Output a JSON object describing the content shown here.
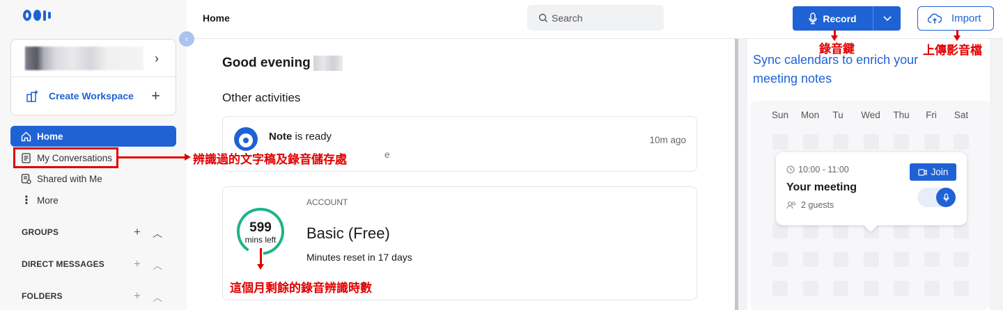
{
  "sidebar": {
    "create_workspace": "Create Workspace",
    "nav": [
      {
        "label": "Home",
        "icon": "home-icon"
      },
      {
        "label": "My Conversations",
        "icon": "conversations-icon"
      },
      {
        "label": "Shared with Me",
        "icon": "shared-icon"
      },
      {
        "label": "More",
        "icon": "more-vertical-icon"
      }
    ],
    "sections": [
      {
        "label": "GROUPS"
      },
      {
        "label": "DIRECT MESSAGES"
      },
      {
        "label": "FOLDERS"
      }
    ]
  },
  "header": {
    "title": "Home",
    "search_placeholder": "Search",
    "record_label": "Record",
    "import_label": "Import"
  },
  "main": {
    "greeting": "Good evening",
    "other_activities": "Other activities",
    "activity": {
      "bold": "Note",
      "rest": " is ready",
      "subtext": "e",
      "time": "10m ago"
    },
    "account": {
      "section_label": "ACCOUNT",
      "minutes": "599",
      "minutes_caption": "mins left",
      "plan": "Basic (Free)",
      "reset": "Minutes reset in 17 days"
    }
  },
  "calendar_panel": {
    "heading": "Sync calendars to enrich your meeting notes",
    "days": [
      "Sun",
      "Mon",
      "Tu",
      "Wed",
      "Thu",
      "Fri",
      "Sat"
    ],
    "meeting": {
      "time": "10:00 - 11:00",
      "title": "Your meeting",
      "guests": "2 guests",
      "join_label": "Join"
    }
  },
  "annotations": {
    "record_key": "錄音鍵",
    "upload": "上傳影音檔",
    "conversations": "辨識過的文字稿及錄音儲存處",
    "minutes_left": "這個月剩餘的錄音辨識時數"
  },
  "colors": {
    "accent": "#1f62d6",
    "annotation": "#e10000",
    "progress": "#1bb48a"
  }
}
